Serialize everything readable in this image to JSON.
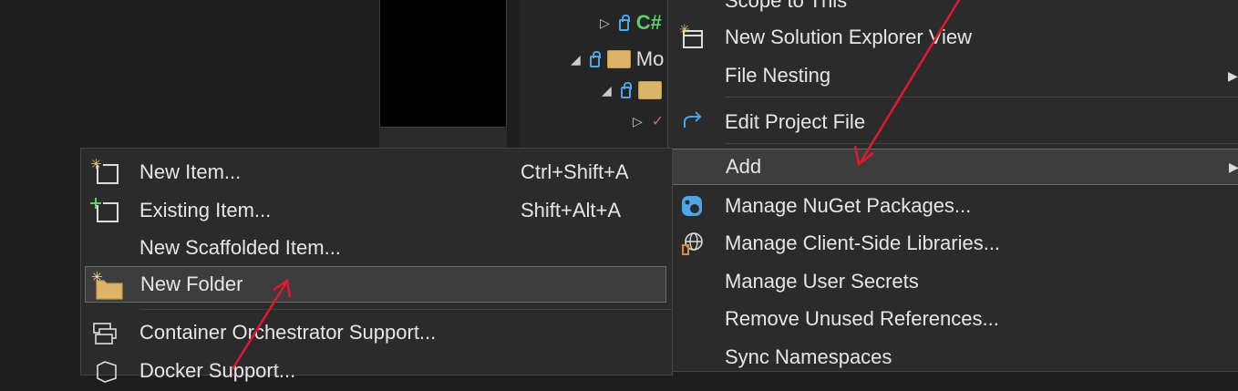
{
  "tree": {
    "items": [
      {
        "prefix": "C#",
        "label": ""
      },
      {
        "prefix": "",
        "label": "Mo"
      },
      {
        "prefix": "",
        "label": ""
      }
    ]
  },
  "main_menu": {
    "items": [
      {
        "label": "Scope to This",
        "icon": "none"
      },
      {
        "label": "New Solution Explorer View",
        "icon": "new-view-icon"
      },
      {
        "label": "File Nesting",
        "icon": "none",
        "submenu": true
      },
      {
        "label": "Edit Project File",
        "icon": "edit-icon"
      },
      {
        "label": "Add",
        "icon": "none",
        "submenu": true,
        "highlighted": true
      },
      {
        "label": "Manage NuGet Packages...",
        "icon": "nuget-icon"
      },
      {
        "label": "Manage Client-Side Libraries...",
        "icon": "libman-icon"
      },
      {
        "label": "Manage User Secrets",
        "icon": "none"
      },
      {
        "label": "Remove Unused References...",
        "icon": "none"
      },
      {
        "label": "Sync Namespaces",
        "icon": "none"
      }
    ]
  },
  "add_submenu": {
    "items": [
      {
        "label": "New Item...",
        "shortcut": "Ctrl+Shift+A",
        "icon": "new-item-icon"
      },
      {
        "label": "Existing Item...",
        "shortcut": "Shift+Alt+A",
        "icon": "existing-item-icon"
      },
      {
        "label": "New Scaffolded Item...",
        "shortcut": "",
        "icon": "none"
      },
      {
        "label": "New Folder",
        "shortcut": "",
        "icon": "new-folder-icon",
        "highlighted": true
      },
      {
        "label": "Container Orchestrator Support...",
        "icon": "container-icon"
      },
      {
        "label": "Docker Support...",
        "icon": "docker-icon"
      }
    ]
  },
  "colors": {
    "menu_bg": "#2b2b2b",
    "highlight_bg": "#3d3d3d",
    "annotation_arrow": "#e0192e",
    "icon_blue": "#4ea6ea",
    "folder_yellow": "#dcb46a"
  }
}
